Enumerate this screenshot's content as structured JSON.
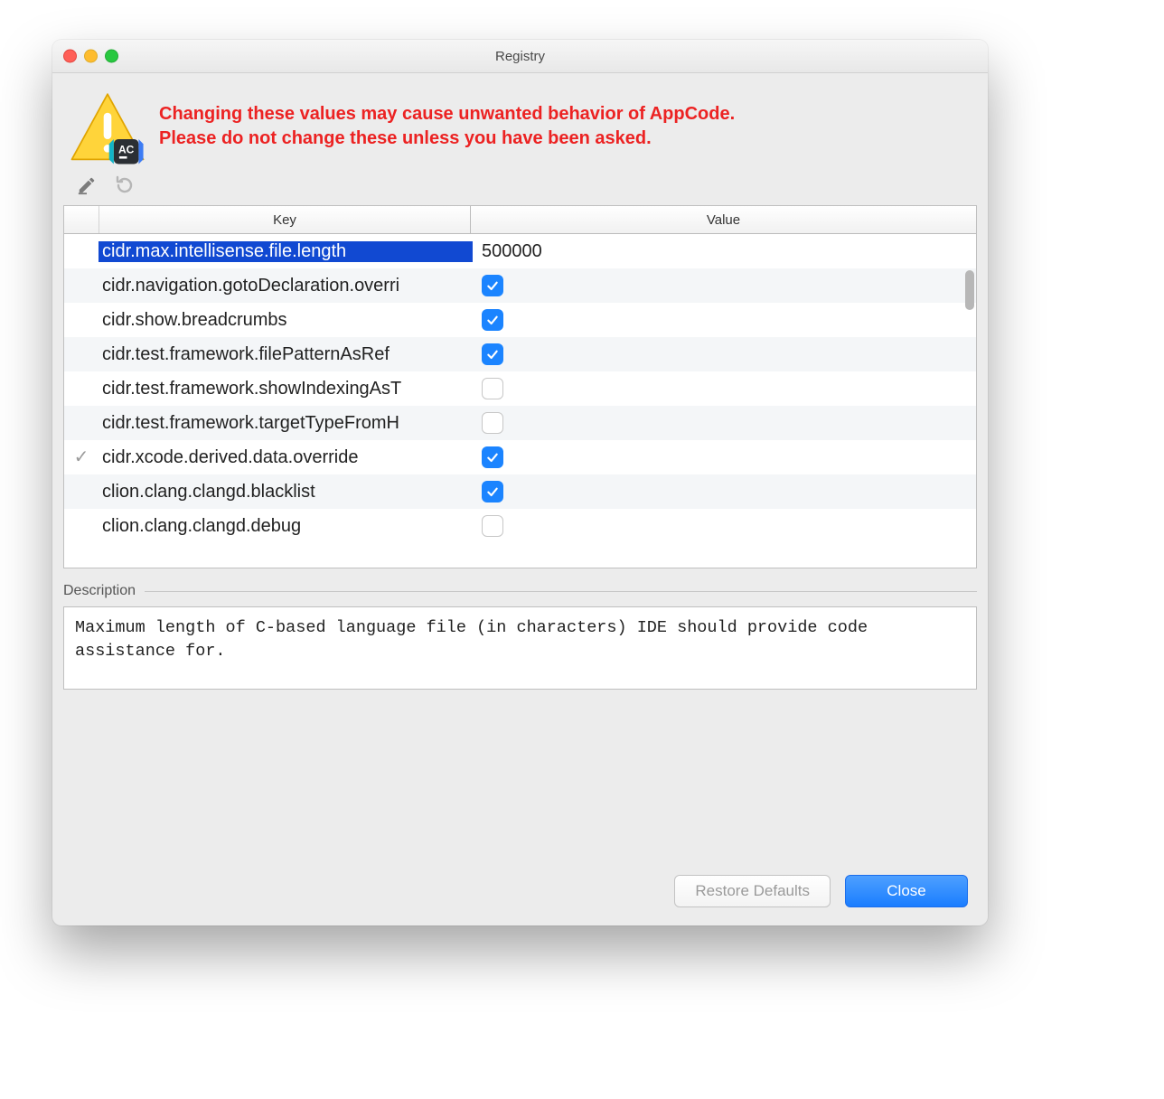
{
  "window": {
    "title": "Registry"
  },
  "warning": {
    "line1": "Changing these values may cause unwanted behavior of AppCode.",
    "line2": "Please do not change these unless you have been asked."
  },
  "table": {
    "headers": {
      "key": "Key",
      "value": "Value"
    },
    "rows": [
      {
        "marker": "",
        "key": "cidr.max.intellisense.file.length",
        "value_type": "text",
        "value": "500000",
        "selected": true
      },
      {
        "marker": "",
        "key": "cidr.navigation.gotoDeclaration.overri",
        "value_type": "checkbox",
        "checked": true
      },
      {
        "marker": "",
        "key": "cidr.show.breadcrumbs",
        "value_type": "checkbox",
        "checked": true
      },
      {
        "marker": "",
        "key": "cidr.test.framework.filePatternAsRef",
        "value_type": "checkbox",
        "checked": true
      },
      {
        "marker": "",
        "key": "cidr.test.framework.showIndexingAsT",
        "value_type": "checkbox",
        "checked": false
      },
      {
        "marker": "",
        "key": "cidr.test.framework.targetTypeFromH",
        "value_type": "checkbox",
        "checked": false
      },
      {
        "marker": "✓",
        "key": "cidr.xcode.derived.data.override",
        "value_type": "checkbox",
        "checked": true
      },
      {
        "marker": "",
        "key": "clion.clang.clangd.blacklist",
        "value_type": "checkbox",
        "checked": true
      },
      {
        "marker": "",
        "key": "clion.clang.clangd.debug",
        "value_type": "checkbox",
        "checked": false
      }
    ]
  },
  "description": {
    "label": "Description",
    "text": "Maximum length of C-based language file (in characters) IDE should provide code assistance for."
  },
  "buttons": {
    "restore": "Restore Defaults",
    "close": "Close"
  }
}
